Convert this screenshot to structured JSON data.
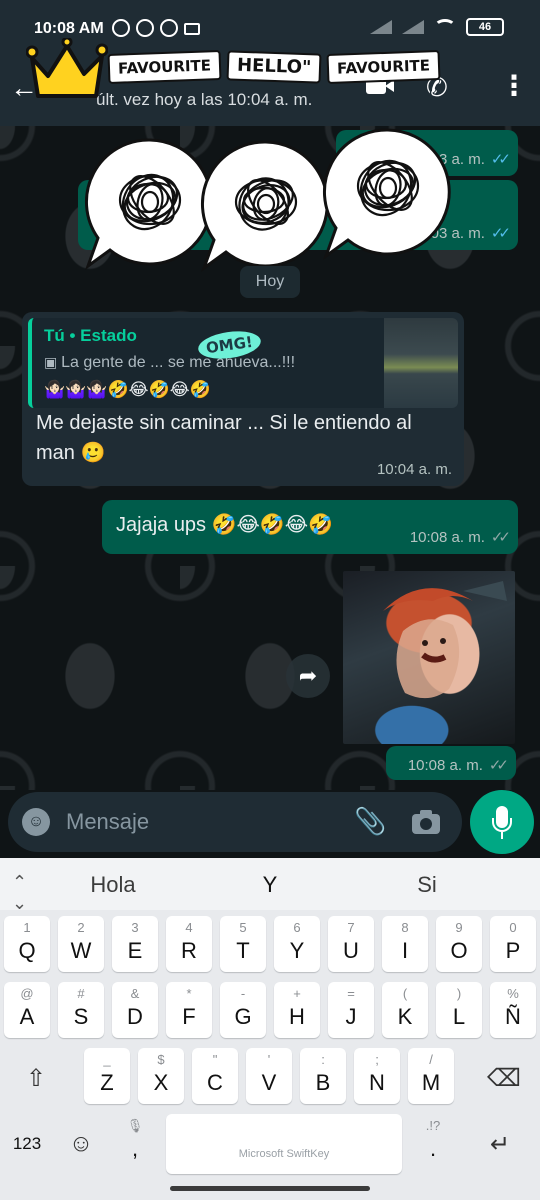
{
  "status_bar": {
    "time": "10:08 AM",
    "battery": "46"
  },
  "header": {
    "last_seen": "últ. vez hoy a las 10:04 a. m."
  },
  "sticker_overlay": {
    "tags": [
      "FAVOURITE",
      "HELLO\"",
      "FAVOURITE"
    ],
    "omg": "OMG!"
  },
  "chat": {
    "scribble_bubbles": [
      {
        "time": "10:03 a. m.",
        "ticks": "✓✓"
      },
      {
        "time": "10:03 a. m.",
        "ticks": "✓✓"
      }
    ],
    "day_chip": "Hoy",
    "reply_message": {
      "quote_author": "Tú • Estado",
      "quote_text": "La gente de ... se me ahueva...!!!",
      "quote_emojis": "🤷🏻‍♀️🤷🏻‍♀️🤷🏻‍♀️🤣😂🤣😂🤣",
      "text": "Me dejaste sin caminar ... Si le entiendo al man 🥲",
      "time": "10:04 a. m."
    },
    "out_message": {
      "text": "Jajaja ups 🤣😂🤣😂🤣",
      "time": "10:08 a. m.",
      "ticks": "✓✓"
    },
    "image_message": {
      "time": "10:08 a. m.",
      "ticks": "✓✓"
    }
  },
  "composer": {
    "placeholder": "Mensaje"
  },
  "keyboard": {
    "suggestions": [
      "Hola",
      "Y",
      "Si"
    ],
    "row1": [
      {
        "main": "Q",
        "alt": "1"
      },
      {
        "main": "W",
        "alt": "2"
      },
      {
        "main": "E",
        "alt": "3"
      },
      {
        "main": "R",
        "alt": "4"
      },
      {
        "main": "T",
        "alt": "5"
      },
      {
        "main": "Y",
        "alt": "6"
      },
      {
        "main": "U",
        "alt": "7"
      },
      {
        "main": "I",
        "alt": "8"
      },
      {
        "main": "O",
        "alt": "9"
      },
      {
        "main": "P",
        "alt": "0"
      }
    ],
    "row2": [
      {
        "main": "A",
        "alt": "@"
      },
      {
        "main": "S",
        "alt": "#"
      },
      {
        "main": "D",
        "alt": "&"
      },
      {
        "main": "F",
        "alt": "*"
      },
      {
        "main": "G",
        "alt": "-"
      },
      {
        "main": "H",
        "alt": "+"
      },
      {
        "main": "J",
        "alt": "="
      },
      {
        "main": "K",
        "alt": "("
      },
      {
        "main": "L",
        "alt": ")"
      },
      {
        "main": "Ñ",
        "alt": "%"
      }
    ],
    "row3": [
      {
        "main": "Z",
        "alt": "_"
      },
      {
        "main": "X",
        "alt": "$"
      },
      {
        "main": "C",
        "alt": "\""
      },
      {
        "main": "V",
        "alt": "'"
      },
      {
        "main": "B",
        "alt": ":"
      },
      {
        "main": "N",
        "alt": ";"
      },
      {
        "main": "M",
        "alt": "/"
      }
    ],
    "numbers_key": "123",
    "comma_key": ",",
    "period_key": ".",
    "space_brand": "Microsoft SwiftKey"
  }
}
